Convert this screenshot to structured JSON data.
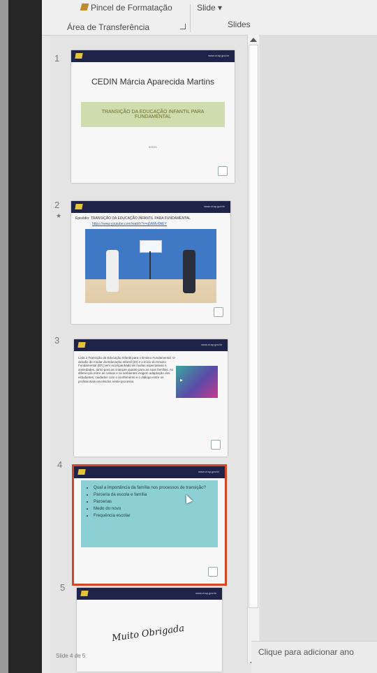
{
  "ribbon": {
    "format_painter": "Pincel de Formatação",
    "slide_menu": "Slide ▾",
    "clipboard_group": "Área de Transferência",
    "slides_group": "Slides"
  },
  "thumbnails": {
    "slide1": {
      "number": "1",
      "url": "www.ct.sp.gov.br",
      "title": "CEDIN Márcia Aparecida Martins",
      "banner": "TRANSIÇÃO DA EDUCAÇÃO INFANTIL PARA FUNDAMENTAL",
      "date": "5/2021"
    },
    "slide2": {
      "number": "2",
      "marker": "★",
      "url": "www.ct.sp.gov.br",
      "text": "Episódio: TRANSIÇÃO DA EDUCAÇÃO INFANTIL PARA FUNDAMENTAL",
      "link": "https://www.youtube.com/watch?v=q5AMvi9kEY"
    },
    "slide3": {
      "number": "3",
      "url": "www.ct.sp.gov.br",
      "text": "Lista 2 Transição da Educação Infantil para o Ensino Fundamental. O desafio de mudar da Educação Infantil (EI) e o início do Ensino Fundamental (EF) vem acompanhado de muitas expectativas e ansiedades, tanto para as crianças quanto para as suas famílias. As diferenças entre as rotinas e os ambientes exigem adaptação dos estudantes, cuidados com o acolhimento e o diálogo entre os profissionais envolvidos neste processo."
    },
    "slide4": {
      "number": "4",
      "url": "www.ct.sp.gov.br",
      "bullets": [
        "Qual a importância da família nos processos de transição?",
        "Parceria da escola e família",
        "Parcerias",
        "Medo do novo",
        "Frequência escolar"
      ]
    },
    "slide5": {
      "number": "5",
      "url": "www.ct.sp.gov.br",
      "script": "Muito Obrigada"
    }
  },
  "status": {
    "slide_count": "Slide 4 de 5"
  },
  "notes": {
    "placeholder": "Clique para adicionar ano"
  },
  "colors": {
    "selection_outline": "#d24726",
    "slide_header": "#1f2347",
    "banner_green": "#cfdcae",
    "bullet_box": "#8dd0d4"
  }
}
